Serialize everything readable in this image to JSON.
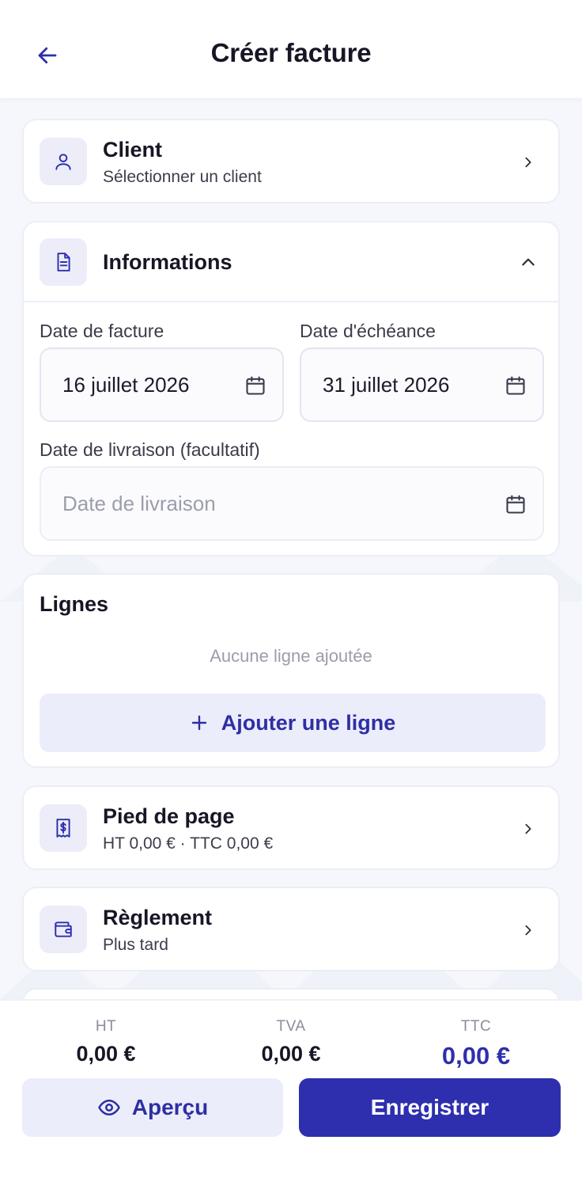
{
  "header": {
    "title": "Créer facture"
  },
  "client": {
    "title": "Client",
    "subtitle": "Sélectionner un client"
  },
  "informations": {
    "title": "Informations",
    "invoice_date_label": "Date de facture",
    "invoice_date_value": "16 juillet 2026",
    "due_date_label": "Date d'échéance",
    "due_date_value": "31 juillet 2026",
    "delivery_date_label": "Date de livraison (facultatif)",
    "delivery_date_placeholder": "Date de livraison"
  },
  "lines": {
    "title": "Lignes",
    "empty_text": "Aucune ligne ajoutée",
    "add_label": "Ajouter une ligne"
  },
  "footer_section": {
    "title": "Pied de page",
    "subtitle": "HT 0,00 € · TTC 0,00 €"
  },
  "payment": {
    "title": "Règlement",
    "subtitle": "Plus tard"
  },
  "totals": {
    "ht_label": "HT",
    "ht_value": "0,00 €",
    "tva_label": "TVA",
    "tva_value": "0,00 €",
    "ttc_label": "TTC",
    "ttc_value": "0,00 €"
  },
  "actions": {
    "preview_label": "Aperçu",
    "save_label": "Enregistrer"
  },
  "colors": {
    "accent": "#2e2fae",
    "accent_light": "#ecedfb",
    "background": "#f6f7fc"
  },
  "icons": [
    "arrow-left-icon",
    "user-icon",
    "document-icon",
    "calendar-icon",
    "plus-icon",
    "receipt-icon",
    "wallet-icon",
    "eye-icon",
    "chevron-right-icon",
    "chevron-up-icon"
  ]
}
